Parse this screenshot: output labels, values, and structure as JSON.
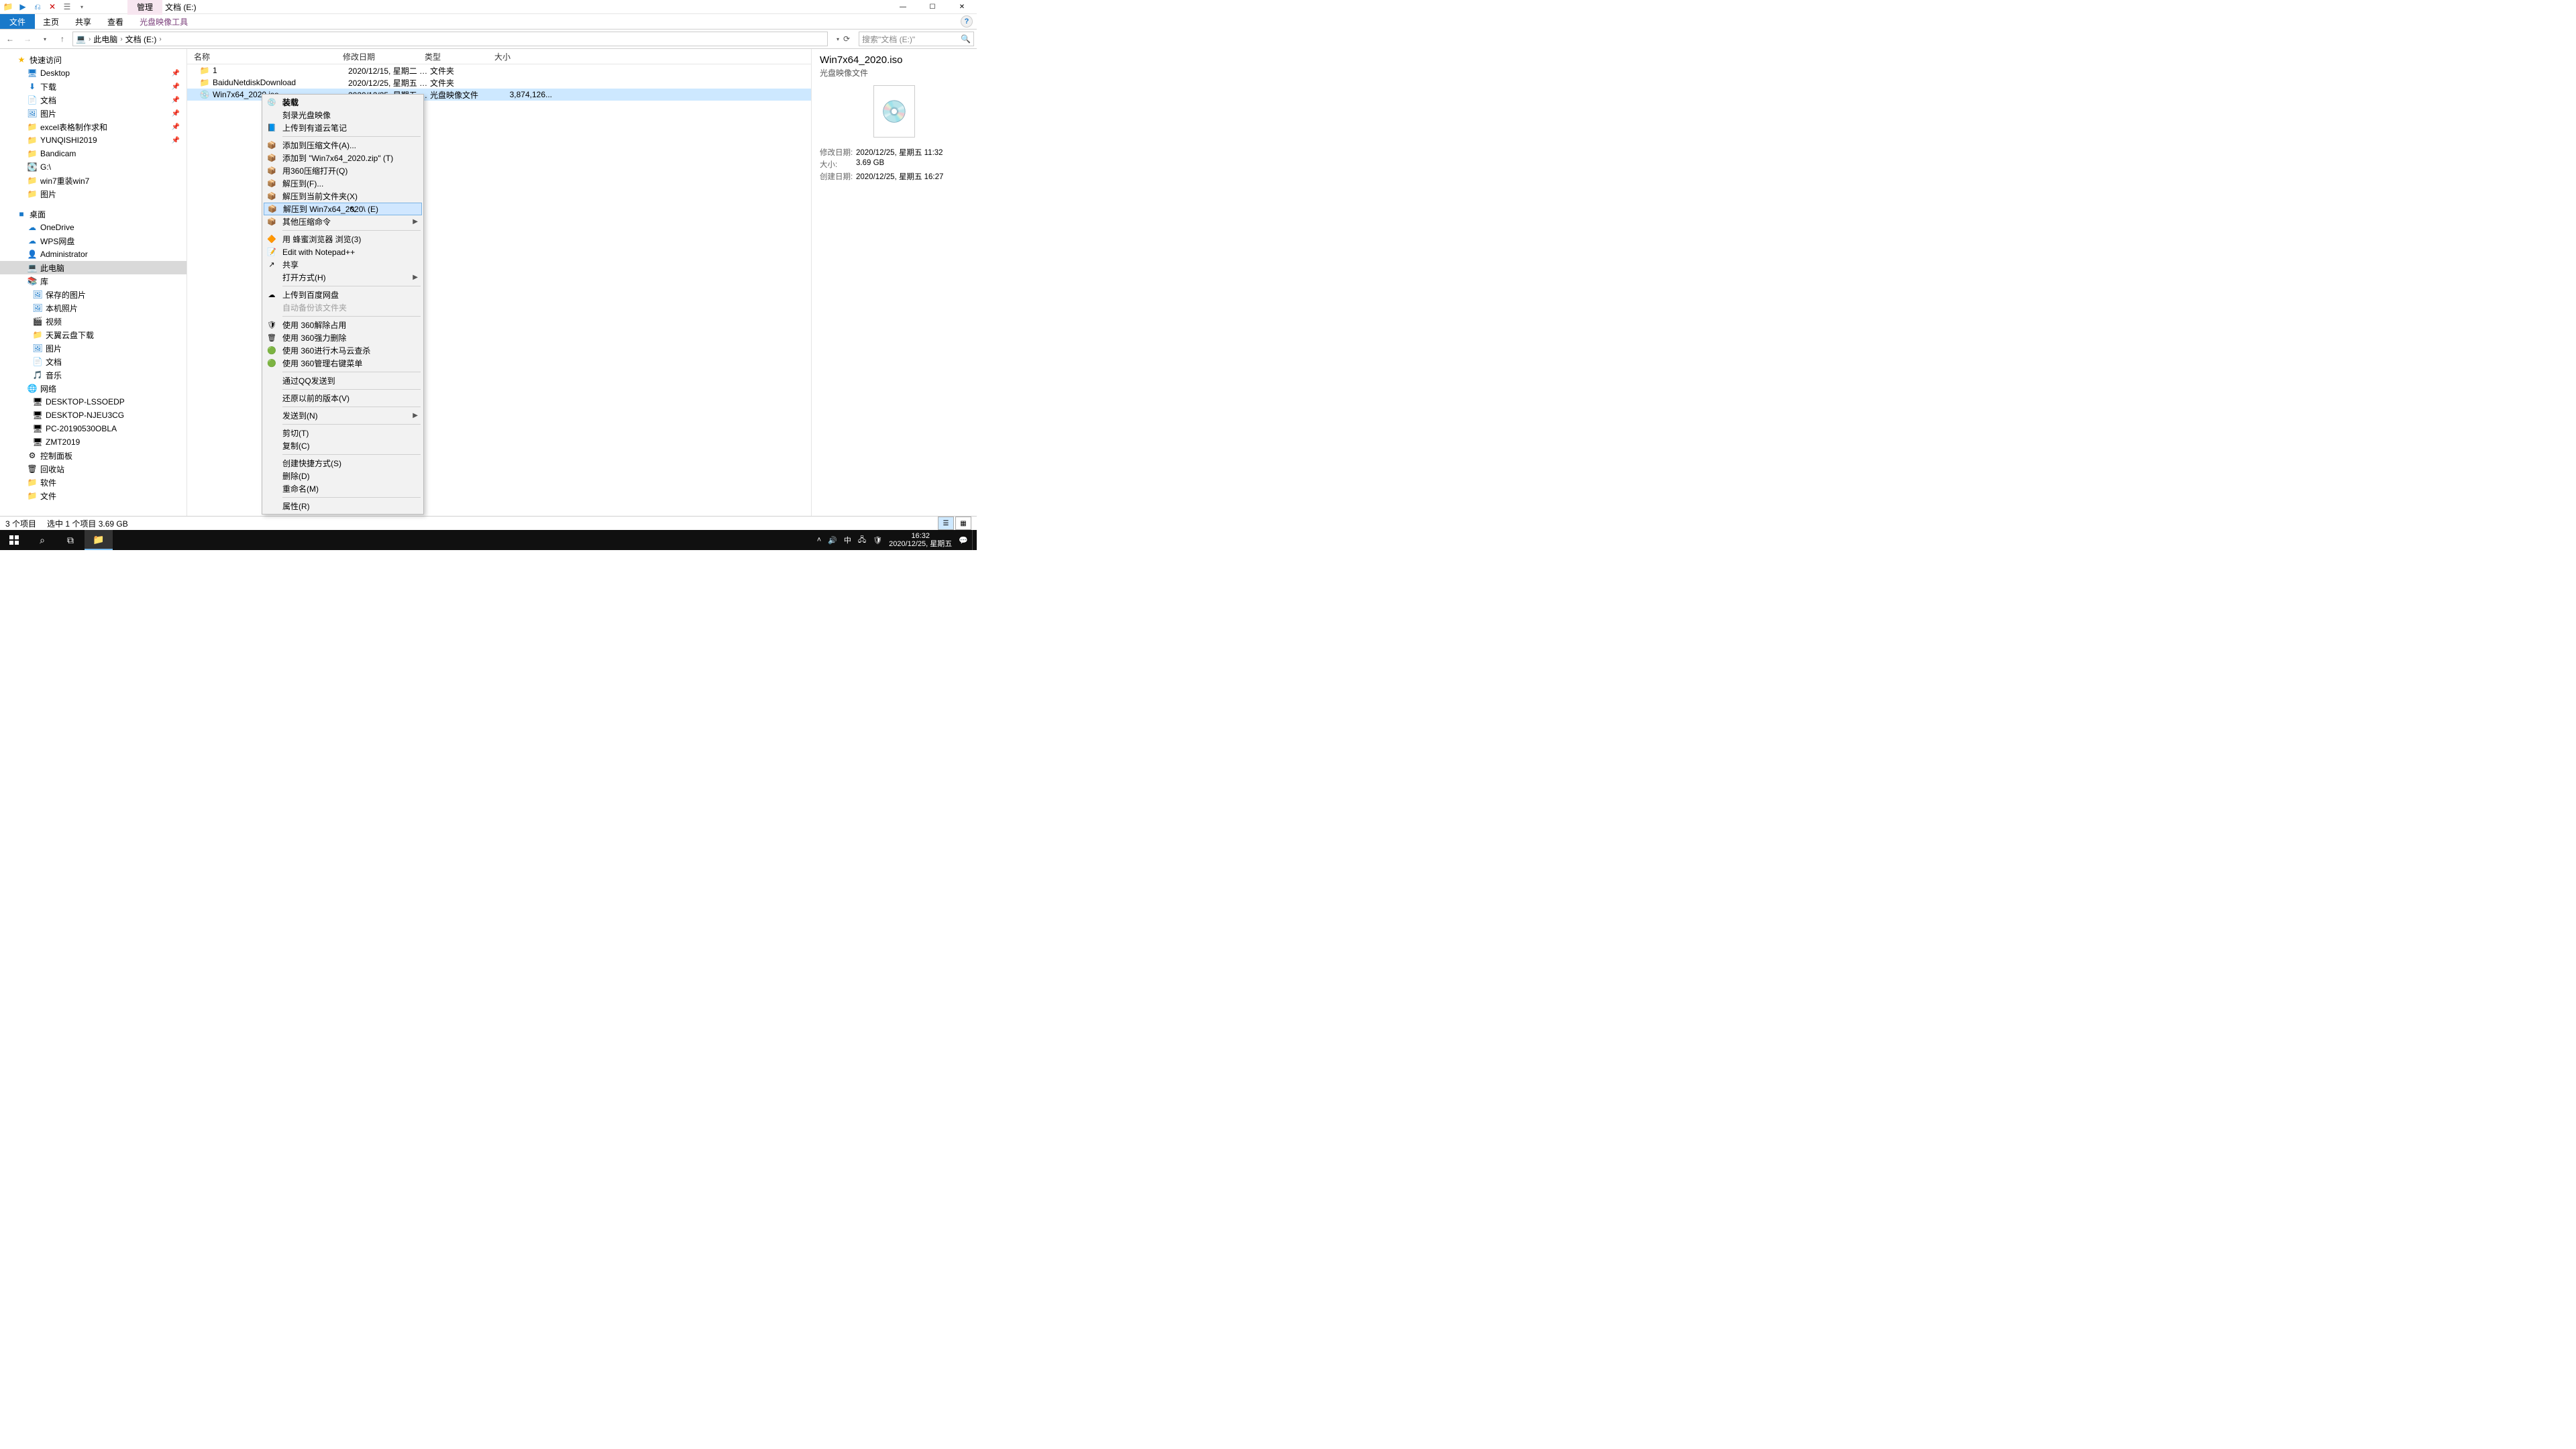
{
  "title_tab": "管理",
  "title_text": "文档 (E:)",
  "ribbon": {
    "file": "文件",
    "tabs": [
      "主页",
      "共享",
      "查看"
    ],
    "tool": "光盘映像工具"
  },
  "breadcrumbs": [
    "此电脑",
    "文档 (E:)"
  ],
  "search_placeholder": "搜索\"文档 (E:)\"",
  "tree_quick_access": "快速访问",
  "tree_qa_items": [
    {
      "label": "Desktop",
      "icon": "desktop",
      "pinned": true
    },
    {
      "label": "下载",
      "icon": "download",
      "pinned": true
    },
    {
      "label": "文档",
      "icon": "doc",
      "pinned": true
    },
    {
      "label": "图片",
      "icon": "img",
      "pinned": true
    },
    {
      "label": "excel表格制作求和",
      "icon": "folder",
      "pinned": true
    },
    {
      "label": "YUNQISHI2019",
      "icon": "folder",
      "pinned": true
    },
    {
      "label": "Bandicam",
      "icon": "folder",
      "pinned": false
    },
    {
      "label": "G:\\",
      "icon": "disk",
      "pinned": false
    },
    {
      "label": "win7重装win7",
      "icon": "folder",
      "pinned": false
    },
    {
      "label": "图片",
      "icon": "folder",
      "pinned": false
    }
  ],
  "tree_desktop": "桌面",
  "tree_desktop_items": [
    {
      "label": "OneDrive",
      "icon": "cloud"
    },
    {
      "label": "WPS网盘",
      "icon": "cloud"
    },
    {
      "label": "Administrator",
      "icon": "user"
    },
    {
      "label": "此电脑",
      "icon": "pc",
      "selected": true
    },
    {
      "label": "库",
      "icon": "lib"
    }
  ],
  "tree_lib_items": [
    {
      "label": "保存的图片",
      "icon": "img"
    },
    {
      "label": "本机照片",
      "icon": "img"
    },
    {
      "label": "视频",
      "icon": "vid"
    },
    {
      "label": "天翼云盘下载",
      "icon": "folder"
    },
    {
      "label": "图片",
      "icon": "img"
    },
    {
      "label": "文档",
      "icon": "doc"
    },
    {
      "label": "音乐",
      "icon": "music"
    }
  ],
  "tree_network": "网络",
  "tree_net_items": [
    {
      "label": "DESKTOP-LSSOEDP",
      "icon": "net"
    },
    {
      "label": "DESKTOP-NJEU3CG",
      "icon": "net"
    },
    {
      "label": "PC-20190530OBLA",
      "icon": "net"
    },
    {
      "label": "ZMT2019",
      "icon": "net"
    }
  ],
  "tree_bottom": [
    {
      "label": "控制面板",
      "icon": "ctrl"
    },
    {
      "label": "回收站",
      "icon": "recycle"
    },
    {
      "label": "软件",
      "icon": "folder"
    },
    {
      "label": "文件",
      "icon": "folder"
    }
  ],
  "columns": {
    "name": "名称",
    "mod": "修改日期",
    "type": "类型",
    "size": "大小"
  },
  "rows": [
    {
      "name": "1",
      "mod": "2020/12/15, 星期二 1...",
      "type": "文件夹",
      "size": "",
      "icon": "folder",
      "selected": false
    },
    {
      "name": "BaiduNetdiskDownload",
      "mod": "2020/12/25, 星期五 1...",
      "type": "文件夹",
      "size": "",
      "icon": "folder",
      "selected": false
    },
    {
      "name": "Win7x64_2020.iso",
      "mod": "2020/12/25, 星期五 1...",
      "type": "光盘映像文件",
      "size": "3,874,126...",
      "icon": "iso",
      "selected": true
    }
  ],
  "context_menu": [
    {
      "label": "装载",
      "icon": "💿",
      "bold": true
    },
    {
      "label": "刻录光盘映像"
    },
    {
      "label": "上传到有道云笔记",
      "icon": "📘"
    },
    {
      "sep": true
    },
    {
      "label": "添加到压缩文件(A)...",
      "icon": "📦"
    },
    {
      "label": "添加到 \"Win7x64_2020.zip\" (T)",
      "icon": "📦"
    },
    {
      "label": "用360压缩打开(Q)",
      "icon": "📦"
    },
    {
      "label": "解压到(F)...",
      "icon": "📦"
    },
    {
      "label": "解压到当前文件夹(X)",
      "icon": "📦"
    },
    {
      "label": "解压到 Win7x64_2020\\ (E)",
      "icon": "📦",
      "hover": true
    },
    {
      "label": "其他压缩命令",
      "icon": "📦",
      "arrow": true
    },
    {
      "sep": true
    },
    {
      "label": "用 蜂蜜浏览器 浏览(3)",
      "icon": "🔶"
    },
    {
      "label": "Edit with Notepad++",
      "icon": "📝"
    },
    {
      "label": "共享",
      "icon": "↗"
    },
    {
      "label": "打开方式(H)",
      "arrow": true
    },
    {
      "sep": true
    },
    {
      "label": "上传到百度网盘",
      "icon": "☁"
    },
    {
      "label": "自动备份该文件夹",
      "disabled": true
    },
    {
      "sep": true
    },
    {
      "label": "使用 360解除占用",
      "icon": "🛡"
    },
    {
      "label": "使用 360强力删除",
      "icon": "🗑"
    },
    {
      "label": "使用 360进行木马云查杀",
      "icon": "🟢"
    },
    {
      "label": "使用 360管理右键菜单",
      "icon": "🟢"
    },
    {
      "sep": true
    },
    {
      "label": "通过QQ发送到"
    },
    {
      "sep": true
    },
    {
      "label": "还原以前的版本(V)"
    },
    {
      "sep": true
    },
    {
      "label": "发送到(N)",
      "arrow": true
    },
    {
      "sep": true
    },
    {
      "label": "剪切(T)"
    },
    {
      "label": "复制(C)"
    },
    {
      "sep": true
    },
    {
      "label": "创建快捷方式(S)"
    },
    {
      "label": "删除(D)"
    },
    {
      "label": "重命名(M)"
    },
    {
      "sep": true
    },
    {
      "label": "属性(R)"
    }
  ],
  "preview": {
    "title": "Win7x64_2020.iso",
    "type": "光盘映像文件",
    "mod_label": "修改日期:",
    "mod_value": "2020/12/25, 星期五 11:32",
    "size_label": "大小:",
    "size_value": "3.69 GB",
    "create_label": "创建日期:",
    "create_value": "2020/12/25, 星期五 16:27"
  },
  "status": {
    "count": "3 个项目",
    "sel": "选中 1 个项目  3.69 GB"
  },
  "taskbar": {
    "time": "16:32",
    "date": "2020/12/25, 星期五",
    "ime": "中"
  }
}
